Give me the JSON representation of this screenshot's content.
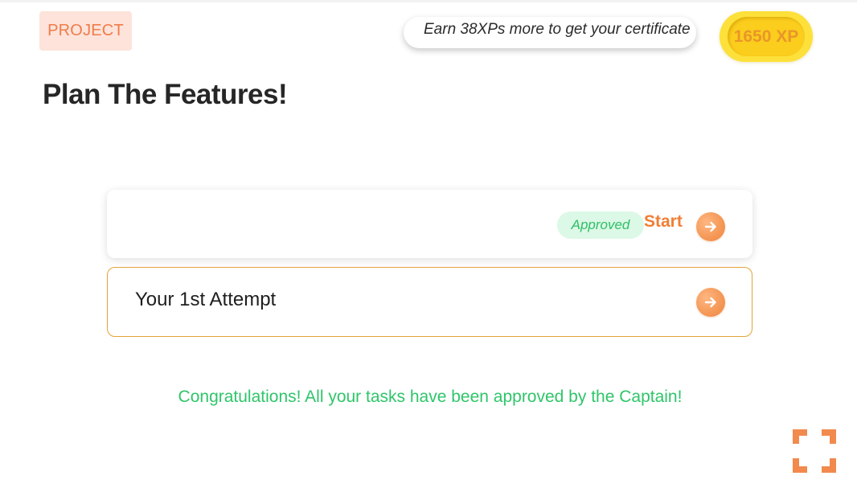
{
  "header": {
    "badge_label": "PROJECT",
    "xp_message": "Earn 38XPs more to get your certificate",
    "xp_total": "1650 XP"
  },
  "page": {
    "title": "Plan The Features!"
  },
  "task": {
    "status": "Approved",
    "action_label": "Start"
  },
  "attempt": {
    "label": "Your 1st Attempt"
  },
  "footer": {
    "congrats_message": "Congratulations! All your tasks have been approved by the Captain!"
  },
  "icons": {
    "task_arrow": "arrow-right-icon",
    "attempt_arrow": "arrow-right-icon",
    "fullscreen": "fullscreen-icon"
  },
  "colors": {
    "accent_orange": "#f07e33",
    "success_green": "#2fc56a",
    "badge_bg": "#fde3da",
    "coin_yellow": "#fde03a",
    "approved_bg": "#dcf8e6"
  }
}
